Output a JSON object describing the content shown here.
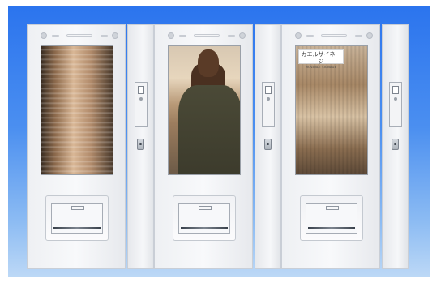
{
  "scene": {
    "background_gradient": [
      "#2b74ee",
      "#4b8ff0",
      "#8dbcf3",
      "#bcd8f6"
    ],
    "panel_color": "#f4f5f8"
  },
  "machines": [
    {
      "screen_content": "blurred-subway-interior",
      "logo": null
    },
    {
      "screen_content": "person-standing-in-station",
      "logo": null
    },
    {
      "screen_content": "blurred-train-passing",
      "logo": {
        "main": "カエルサイネージ",
        "sub": "MOVABLE SIGNAGE"
      }
    }
  ],
  "icons": {
    "top_bar": "indicator-dots-icon",
    "scanner": "card-reader-icon",
    "lock": "key-lock-icon",
    "tray": "dispense-tray-icon"
  }
}
